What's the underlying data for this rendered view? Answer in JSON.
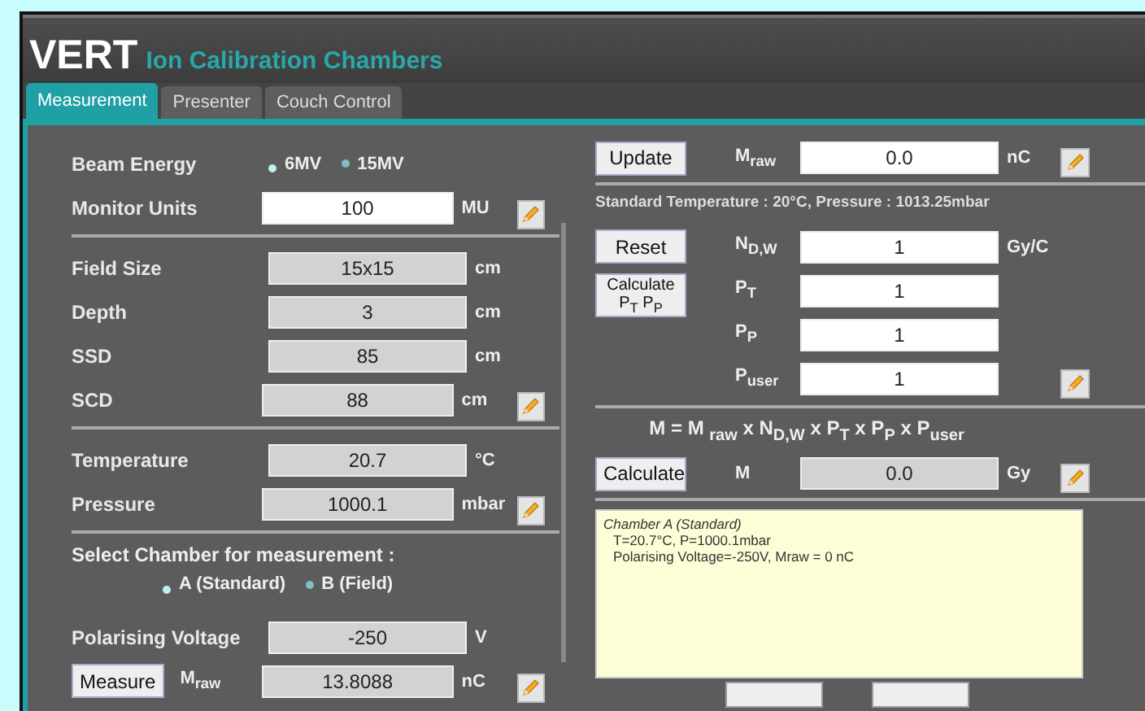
{
  "header": {
    "logo": "VERT",
    "title": "Ion Calibration Chambers"
  },
  "tabs": [
    {
      "label": "Measurement",
      "selected": true
    },
    {
      "label": "Presenter",
      "selected": false
    },
    {
      "label": "Couch Control",
      "selected": false
    }
  ],
  "left": {
    "beam_energy": {
      "label": "Beam Energy",
      "options": [
        {
          "label": "6MV",
          "selected": true
        },
        {
          "label": "15MV",
          "selected": false
        }
      ]
    },
    "rows": [
      {
        "label": "Monitor Units",
        "value": "100",
        "unit": "MU",
        "editable": true,
        "pencil": true,
        "divider_after": true
      },
      {
        "label": "Field Size",
        "value": "15x15",
        "unit": "cm",
        "editable": false,
        "pencil": false,
        "divider_after": false
      },
      {
        "label": "Depth",
        "value": "3",
        "unit": "cm",
        "editable": false,
        "pencil": false,
        "divider_after": false
      },
      {
        "label": "SSD",
        "value": "85",
        "unit": "cm",
        "editable": false,
        "pencil": false,
        "divider_after": false
      },
      {
        "label": "SCD",
        "value": "88",
        "unit": "cm",
        "editable": false,
        "pencil": true,
        "divider_after": true
      },
      {
        "label": "Temperature",
        "value": "20.7",
        "unit": "°C",
        "editable": false,
        "pencil": false,
        "divider_after": false
      },
      {
        "label": "Pressure",
        "value": "1000.1",
        "unit": "mbar",
        "editable": false,
        "pencil": true,
        "divider_after": true
      }
    ],
    "chamber": {
      "label": "Select Chamber for measurement :",
      "options": [
        {
          "label": "A (Standard)",
          "selected": true
        },
        {
          "label": "B (Field)",
          "selected": false
        }
      ]
    },
    "voltage": {
      "label": "Polarising Voltage",
      "value": "-250",
      "unit": "V",
      "editable": false
    },
    "measure": {
      "button": "Measure",
      "label": "M$_{raw}$",
      "value": "13.8088",
      "unit": "nC",
      "editable": false
    }
  },
  "right": {
    "update": {
      "button": "Update",
      "label": "M$_{raw}$",
      "value": "0.0",
      "unit": "nC",
      "editable": true
    },
    "standard": "Standard Temperature : 20°C, Pressure : 1013.25mbar",
    "buttons": [
      {
        "lines": [
          "Reset"
        ]
      },
      {
        "lines": [
          "Calculate",
          "P$_{T}$ P$_{P}$"
        ]
      }
    ],
    "factors": [
      {
        "label": "N$_{D,W}$",
        "value": "1",
        "unit": "Gy/C",
        "editable": true
      },
      {
        "label": "P$_{T}$",
        "value": "1",
        "editable": true
      },
      {
        "label": "P$_{P}$",
        "value": "1",
        "editable": true
      },
      {
        "label": "P$_{user}$",
        "value": "1",
        "editable": true
      }
    ],
    "formula": "M = M $_{raw}$ x N$_{D,W}$ x P$_{T}$ x P$_{P}$ x P$_{user}$",
    "result": {
      "button": "Calculate",
      "label": "M",
      "value": "0.0",
      "unit": "Gy",
      "editable": false
    },
    "notes": [
      "Chamber A (Standard)",
      "T=20.7°C, P=1000.1mbar",
      "Polarising Voltage=-250V, Mraw = 0 nC"
    ]
  }
}
